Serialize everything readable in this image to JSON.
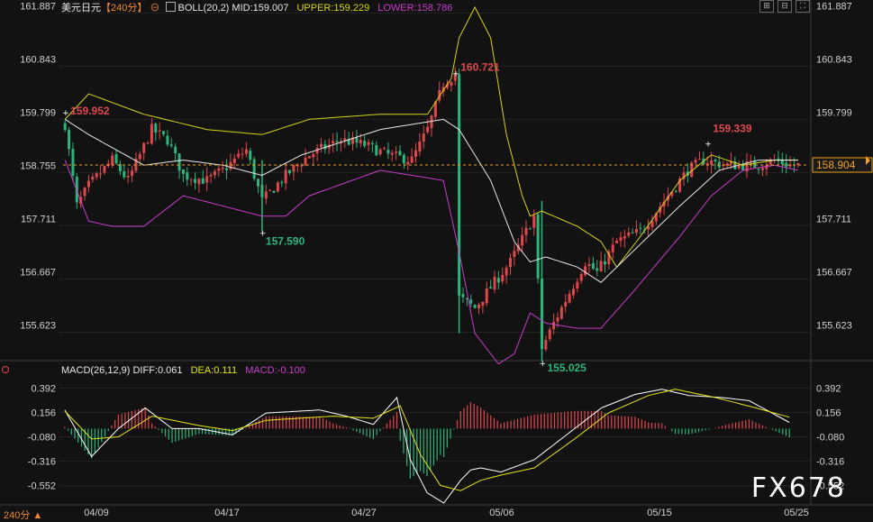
{
  "header": {
    "symbol": "美元日元",
    "period_bracket": "【240分】",
    "boll_label": "BOLL(20,2)",
    "mid_text": "MID:159.007",
    "upper_text": "UPPER:159.229",
    "lower_text": "LOWER:158.786",
    "macd_label": "MACD(26,12,9)",
    "diff_text": "DIFF:0.061",
    "dea_text": "DEA:0.111",
    "macd_text": "MACD:-0.100",
    "period_bottom": "240分",
    "watermark": "FX678"
  },
  "colors": {
    "up": "#e0474c",
    "down": "#2bb57c",
    "mid": "#e8e8e8",
    "upper": "#d4d418",
    "lower": "#c93cc9",
    "diff": "#ffffff",
    "dea": "#e4e41c",
    "macd_text": "#c93cc9",
    "last_price": "#f0a020"
  },
  "chart_data": [
    {
      "type": "candlestick",
      "title": "美元日元 240分",
      "y_ticks": [
        "161.887",
        "160.843",
        "159.799",
        "158.755",
        "157.711",
        "156.667",
        "155.623"
      ],
      "ylim": [
        155.1,
        162.0
      ],
      "x_ticks": [
        "04/09",
        "04/17",
        "04/27",
        "05/06",
        "05/15",
        "05/25"
      ],
      "last_price": "158.904",
      "annotations": [
        {
          "text": "159.952",
          "type": "high"
        },
        {
          "text": "157.590",
          "type": "low"
        },
        {
          "text": "160.721",
          "type": "high"
        },
        {
          "text": "155.025",
          "type": "low"
        },
        {
          "text": "159.339",
          "type": "high"
        }
      ],
      "anchors": {
        "close": [
          [
            0,
            159.7
          ],
          [
            3,
            158.1
          ],
          [
            6,
            158.5
          ],
          [
            12,
            159.0
          ],
          [
            16,
            158.6
          ],
          [
            22,
            159.6
          ],
          [
            26,
            159.4
          ],
          [
            30,
            158.7
          ],
          [
            36,
            158.6
          ],
          [
            40,
            158.8
          ],
          [
            46,
            159.2
          ],
          [
            50,
            158.2
          ],
          [
            56,
            158.7
          ],
          [
            62,
            159.1
          ],
          [
            70,
            159.4
          ],
          [
            76,
            159.3
          ],
          [
            82,
            159.1
          ],
          [
            88,
            159.0
          ],
          [
            92,
            159.6
          ],
          [
            96,
            160.5
          ],
          [
            99,
            160.7
          ],
          [
            100,
            156.3
          ],
          [
            104,
            156.1
          ],
          [
            108,
            156.5
          ],
          [
            113,
            157.0
          ],
          [
            117,
            157.6
          ],
          [
            119,
            157.9
          ],
          [
            121,
            155.3
          ],
          [
            124,
            155.8
          ],
          [
            128,
            156.4
          ],
          [
            132,
            157.0
          ],
          [
            135,
            156.8
          ],
          [
            140,
            157.4
          ],
          [
            146,
            157.6
          ],
          [
            152,
            158.2
          ],
          [
            158,
            158.8
          ],
          [
            162,
            159.0
          ],
          [
            168,
            158.9
          ],
          [
            176,
            158.9
          ],
          [
            180,
            159.0
          ],
          [
            184,
            158.9
          ],
          [
            186,
            158.9
          ]
        ],
        "upper": [
          [
            0,
            159.8
          ],
          [
            6,
            160.3
          ],
          [
            20,
            159.9
          ],
          [
            36,
            159.6
          ],
          [
            50,
            159.5
          ],
          [
            62,
            159.8
          ],
          [
            80,
            159.9
          ],
          [
            92,
            159.9
          ],
          [
            98,
            160.6
          ],
          [
            100,
            161.4
          ],
          [
            104,
            162.0
          ],
          [
            108,
            161.4
          ],
          [
            112,
            159.5
          ],
          [
            116,
            158.3
          ],
          [
            118,
            157.9
          ],
          [
            121,
            158.0
          ],
          [
            130,
            157.7
          ],
          [
            136,
            157.4
          ],
          [
            140,
            156.9
          ],
          [
            146,
            157.5
          ],
          [
            156,
            158.6
          ],
          [
            164,
            159.1
          ],
          [
            172,
            158.9
          ],
          [
            180,
            159.0
          ],
          [
            186,
            159.0
          ]
        ],
        "mid": [
          [
            0,
            159.8
          ],
          [
            6,
            159.5
          ],
          [
            20,
            158.9
          ],
          [
            30,
            159.0
          ],
          [
            40,
            158.9
          ],
          [
            50,
            158.7
          ],
          [
            60,
            159.1
          ],
          [
            80,
            159.6
          ],
          [
            96,
            159.8
          ],
          [
            100,
            159.6
          ],
          [
            108,
            158.6
          ],
          [
            114,
            157.4
          ],
          [
            118,
            157.0
          ],
          [
            122,
            157.1
          ],
          [
            130,
            156.9
          ],
          [
            136,
            156.6
          ],
          [
            144,
            157.2
          ],
          [
            156,
            158.1
          ],
          [
            166,
            158.8
          ],
          [
            176,
            159.0
          ],
          [
            186,
            159.0
          ]
        ],
        "lower": [
          [
            0,
            159.0
          ],
          [
            6,
            157.8
          ],
          [
            12,
            157.7
          ],
          [
            20,
            157.7
          ],
          [
            30,
            158.3
          ],
          [
            40,
            158.1
          ],
          [
            50,
            157.9
          ],
          [
            56,
            157.9
          ],
          [
            62,
            158.3
          ],
          [
            80,
            158.8
          ],
          [
            96,
            158.6
          ],
          [
            100,
            157.2
          ],
          [
            104,
            155.6
          ],
          [
            110,
            155.0
          ],
          [
            114,
            155.2
          ],
          [
            118,
            156.0
          ],
          [
            122,
            155.8
          ],
          [
            130,
            155.7
          ],
          [
            136,
            155.7
          ],
          [
            144,
            156.4
          ],
          [
            156,
            157.5
          ],
          [
            164,
            158.3
          ],
          [
            172,
            158.8
          ],
          [
            180,
            158.9
          ],
          [
            186,
            158.8
          ]
        ]
      }
    },
    {
      "type": "macd",
      "title": "MACD(26,12,9)",
      "y_ticks": [
        "0.392",
        "0.156",
        "-0.080",
        "-0.316",
        "-0.552"
      ],
      "ylim": [
        -0.72,
        0.5
      ],
      "anchors": {
        "diff": [
          [
            0,
            0.18
          ],
          [
            8,
            -0.27
          ],
          [
            16,
            0.0
          ],
          [
            24,
            0.2
          ],
          [
            32,
            0.0
          ],
          [
            40,
            0.0
          ],
          [
            50,
            -0.06
          ],
          [
            60,
            0.15
          ],
          [
            76,
            0.18
          ],
          [
            84,
            0.12
          ],
          [
            92,
            0.04
          ],
          [
            99,
            0.3
          ],
          [
            103,
            -0.3
          ],
          [
            108,
            -0.62
          ],
          [
            113,
            -0.72
          ],
          [
            118,
            -0.5
          ],
          [
            121,
            -0.4
          ],
          [
            124,
            -0.38
          ],
          [
            130,
            -0.42
          ],
          [
            140,
            -0.3
          ],
          [
            150,
            -0.05
          ],
          [
            160,
            0.2
          ],
          [
            170,
            0.33
          ],
          [
            178,
            0.38
          ],
          [
            186,
            0.32
          ],
          [
            196,
            0.3
          ],
          [
            204,
            0.27
          ],
          [
            216,
            0.06
          ]
        ],
        "dea": [
          [
            0,
            0.17
          ],
          [
            8,
            -0.1
          ],
          [
            16,
            -0.08
          ],
          [
            26,
            0.12
          ],
          [
            40,
            0.03
          ],
          [
            50,
            -0.02
          ],
          [
            60,
            0.08
          ],
          [
            80,
            0.12
          ],
          [
            92,
            0.1
          ],
          [
            100,
            0.22
          ],
          [
            106,
            -0.25
          ],
          [
            112,
            -0.55
          ],
          [
            118,
            -0.6
          ],
          [
            124,
            -0.5
          ],
          [
            130,
            -0.45
          ],
          [
            140,
            -0.38
          ],
          [
            152,
            -0.1
          ],
          [
            162,
            0.15
          ],
          [
            174,
            0.32
          ],
          [
            182,
            0.38
          ],
          [
            194,
            0.3
          ],
          [
            206,
            0.2
          ],
          [
            216,
            0.11
          ]
        ]
      }
    }
  ]
}
